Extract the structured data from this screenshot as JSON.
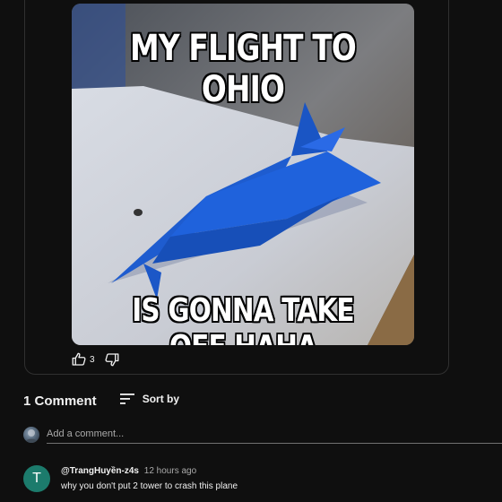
{
  "post": {
    "meme_top": "MY FLIGHT TO OHIO",
    "meme_bottom": "IS GONNA TAKE OFF HAHA",
    "like_count": "3"
  },
  "comments_section": {
    "count_label": "1 Comment",
    "sort_label": "Sort by",
    "add_placeholder": "Add a comment..."
  },
  "comments": [
    {
      "avatar_letter": "T",
      "author": "@TrangHuyền-z4s",
      "time": "12 hours ago",
      "text": "why you don't put 2 tower to crash this plane"
    }
  ],
  "icons": {
    "like": "thumbs-up-icon",
    "dislike": "thumbs-down-icon",
    "sort": "sort-icon"
  },
  "colors": {
    "background": "#0f0f0f",
    "card_border": "#303030",
    "commenter_avatar": "#1c7b6c",
    "plane": "#1f5fd6"
  }
}
